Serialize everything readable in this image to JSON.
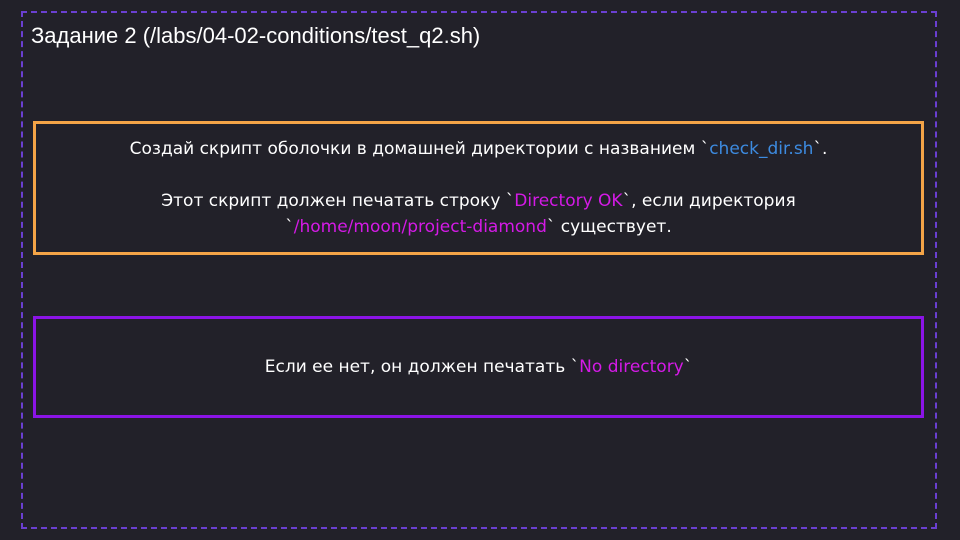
{
  "title": "Задание 2 (/labs/04-02-conditions/test_q2.sh)",
  "task_box": {
    "line1_prefix": "Создай скрипт оболочки в домашней директории с названием `",
    "line1_filename": "check_dir.sh",
    "line1_suffix": "`.",
    "line2_prefix": "Этот скрипт должен печатать строку `",
    "line2_output": "Directory OK",
    "line2_suffix": "`, если директория",
    "line3_prefix": "`",
    "line3_path": "/home/moon/project-diamond",
    "line3_suffix": "` существует."
  },
  "else_box": {
    "prefix": "Если ее нет, он должен печатать `",
    "output": "No directory",
    "suffix": "`"
  },
  "colors": {
    "background": "#222129",
    "frame": "#6a3fd0",
    "task_border": "#f4a447",
    "else_border": "#8b14e6",
    "filename": "#3d8be0",
    "highlight": "#d41ae6"
  }
}
